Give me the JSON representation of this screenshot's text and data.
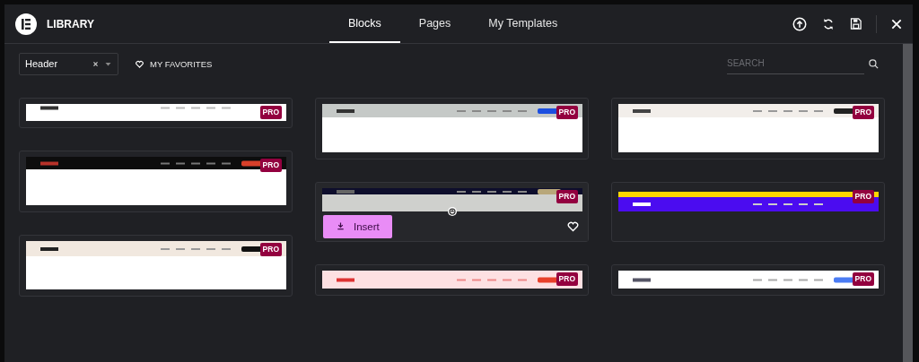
{
  "header": {
    "title": "LIBRARY",
    "tabs": [
      {
        "label": "Blocks",
        "selected": true
      },
      {
        "label": "Pages",
        "selected": false
      },
      {
        "label": "My Templates",
        "selected": false
      }
    ]
  },
  "filters": {
    "category": "Header",
    "favorites": "MY FAVORITES",
    "search": {
      "placeholder": "SEARCH"
    }
  },
  "insert_button": "Insert",
  "columns": [
    [
      {
        "kind": "picture",
        "badge": "PRO",
        "hovered": false
      },
      {
        "kind": "picture",
        "badge": "PRO",
        "hovered": false
      },
      {
        "kind": "picture",
        "badge": "PRO",
        "hovered": false
      }
    ],
    [
      {
        "kind": "picture",
        "badge": "PRO",
        "hovered": false
      },
      {
        "kind": "picture",
        "badge": "PRO",
        "hovered": true
      },
      {
        "kind": "picture",
        "badge": "PRO",
        "hovered": false
      }
    ],
    [
      {
        "kind": "picture",
        "badge": "PRO",
        "hovered": false
      },
      {
        "kind": "picture",
        "badge": "PRO",
        "hovered": false
      },
      {
        "kind": "picture",
        "badge": "PRO",
        "hovered": false
      }
    ]
  ]
}
